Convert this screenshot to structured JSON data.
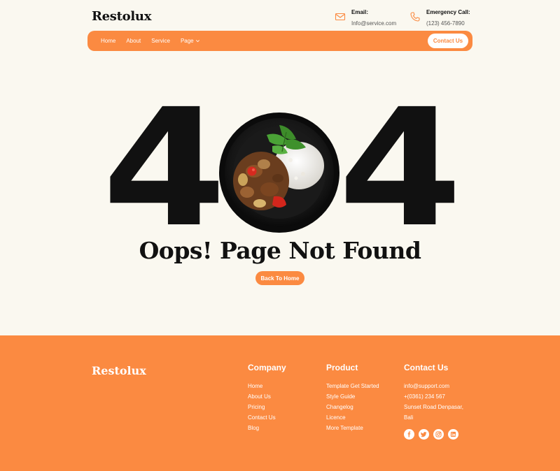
{
  "brand": {
    "name": "Restolux"
  },
  "header": {
    "email": {
      "label": "Email:",
      "value": "Info@service.com",
      "icon": "mail-icon"
    },
    "call": {
      "label": "Emergency Call:",
      "value": "(123) 456-7890",
      "icon": "phone-icon"
    }
  },
  "nav": {
    "items": [
      {
        "label": "Home"
      },
      {
        "label": "About"
      },
      {
        "label": "Service"
      },
      {
        "label": "Page",
        "icon": "chevron-down-icon"
      }
    ],
    "cta": "Contact Us"
  },
  "hero": {
    "left_digit": "4",
    "right_digit": "4",
    "headline": "Oops! Page Not Found",
    "button": "Back To Home"
  },
  "footer": {
    "brand": "Restolux",
    "company": {
      "title": "Company",
      "links": [
        "Home",
        "About Us",
        "Pricing",
        "Contact Us",
        "Blog"
      ]
    },
    "product": {
      "title": "Product",
      "links": [
        "Template Get Started",
        "Style Guide",
        "Changelog",
        "Licence",
        "More Template"
      ]
    },
    "contact": {
      "title": "Contact Us",
      "email": "info@support.com",
      "phone": "+(0361) 234 567",
      "address": "Sunset Road Denpasar, Bali"
    },
    "socials": [
      "facebook-icon",
      "twitter-icon",
      "instagram-icon",
      "linkedin-icon"
    ]
  },
  "colors": {
    "accent": "#fb8a41",
    "background": "#faf8f0",
    "text": "#111111"
  }
}
